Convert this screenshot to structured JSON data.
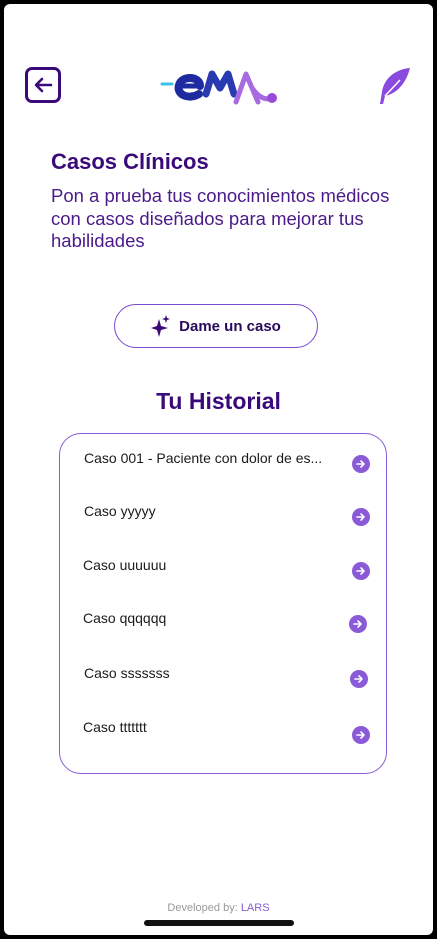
{
  "header": {
    "logo_text": "eMa"
  },
  "intro": {
    "title": "Casos Clínicos",
    "subtitle": "Pon a prueba tus conocimientos médicos con casos diseñados para mejorar tus habilidades"
  },
  "cta": {
    "label": "Dame un caso"
  },
  "history": {
    "title": "Tu Historial",
    "items": [
      {
        "label": "Caso 001 - Paciente con dolor de es..."
      },
      {
        "label": "Caso yyyyy"
      },
      {
        "label": "Caso uuuuuu"
      },
      {
        "label": "Caso qqqqqq"
      },
      {
        "label": "Caso sssssss"
      },
      {
        "label": "Caso ttttttt"
      }
    ]
  },
  "footer": {
    "prefix": "Developed by:",
    "brand": "LARS"
  },
  "colors": {
    "primary": "#3a0a7a",
    "accent": "#8a5ad8",
    "logo_blue": "#1e2aa0",
    "logo_cyan": "#3cc2e6"
  }
}
